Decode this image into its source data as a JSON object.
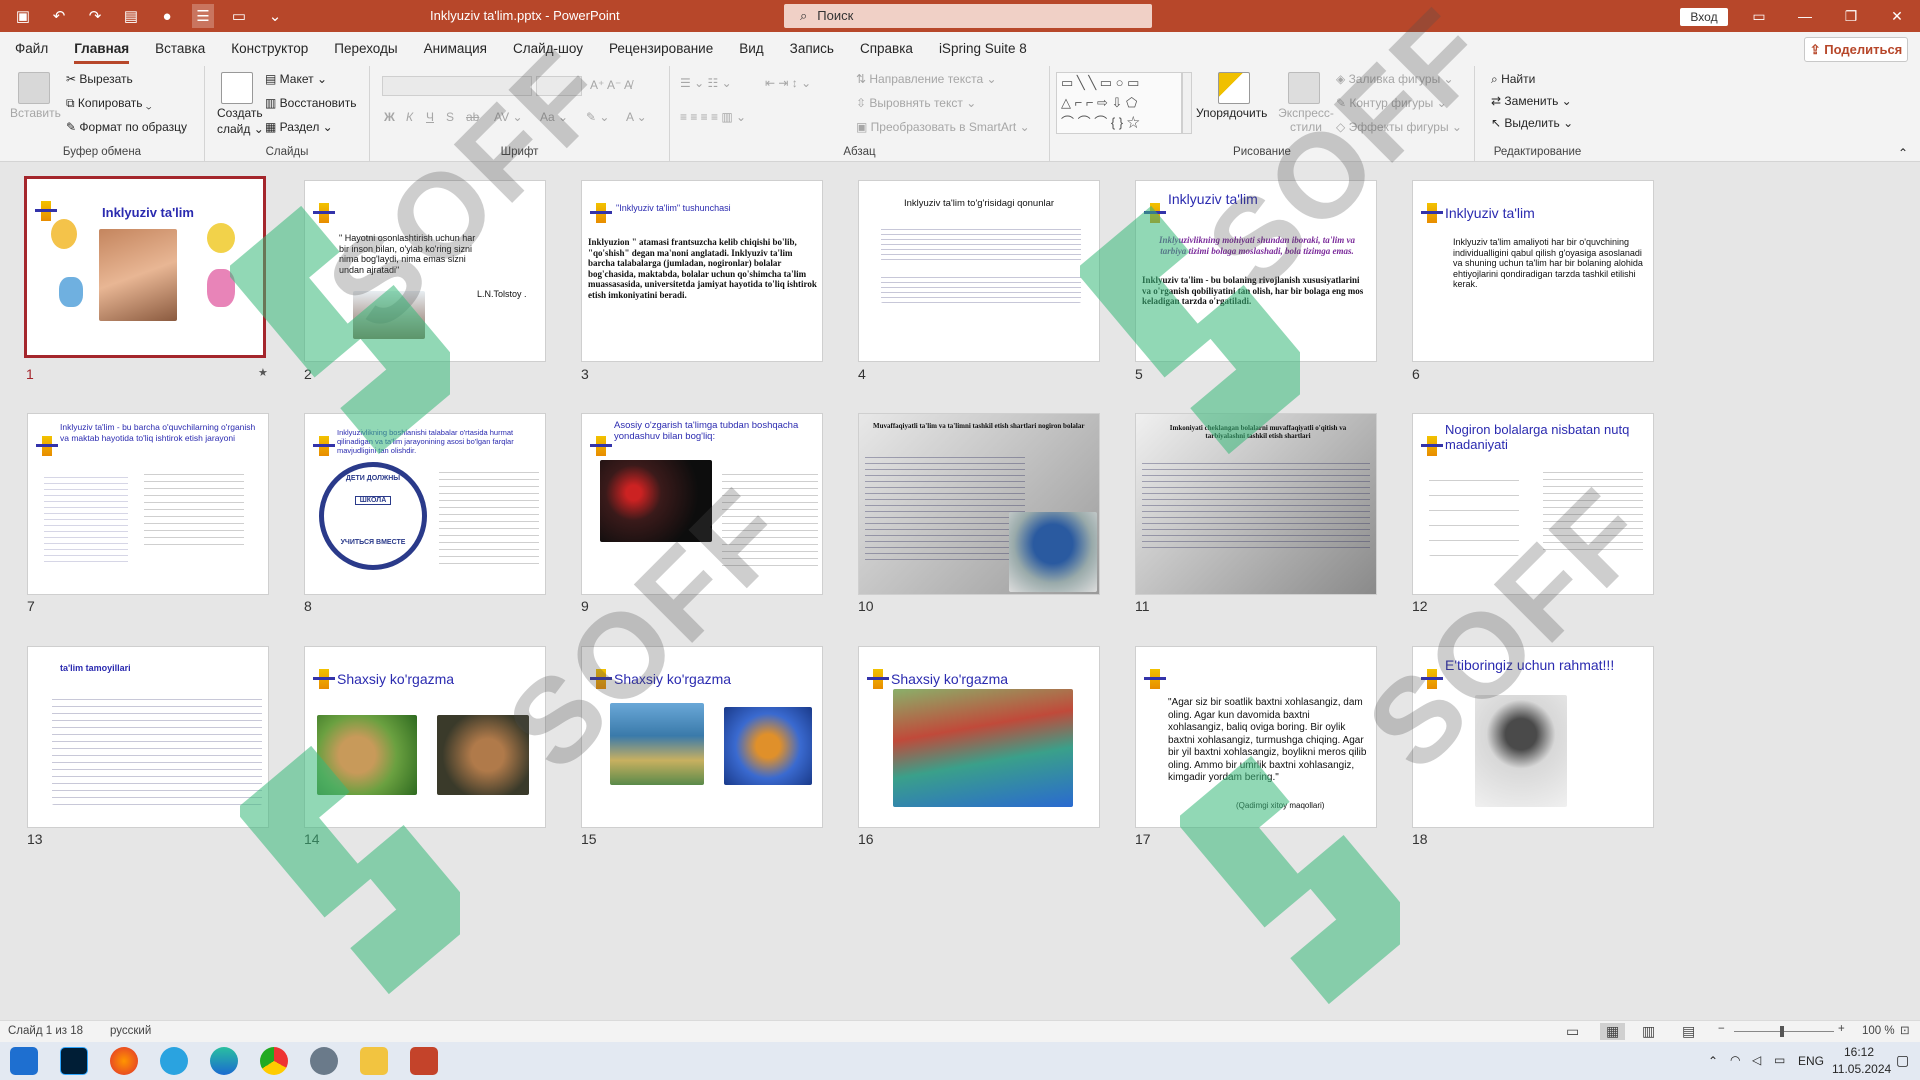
{
  "titlebar": {
    "doc_title": "Inklyuziv ta'lim.pptx  -  PowerPoint",
    "search_placeholder": "Поиск",
    "login": "Вход"
  },
  "tabs": [
    "Файл",
    "Главная",
    "Вставка",
    "Конструктор",
    "Переходы",
    "Анимация",
    "Слайд-шоу",
    "Рецензирование",
    "Вид",
    "Запись",
    "Справка",
    "iSpring Suite 8"
  ],
  "share_label": "Поделиться",
  "ribbon": {
    "clipboard": {
      "paste": "Вставить",
      "cut": "Вырезать",
      "copy": "Копировать",
      "format": "Формат по образцу",
      "label": "Буфер обмена"
    },
    "slides": {
      "create": "Создать",
      "slide": "слайд",
      "layout": "Макет",
      "restore": "Восстановить",
      "section": "Раздел",
      "label": "Слайды"
    },
    "font": {
      "label": "Шрифт"
    },
    "paragraph": {
      "text_dir": "Направление текста",
      "align_text": "Выровнять текст",
      "smartart": "Преобразовать в SmartArt",
      "label": "Абзац"
    },
    "drawing": {
      "arrange": "Упорядочить",
      "styles": "Экспресс-стили",
      "fill": "Заливка фигуры",
      "outline": "Контур фигуры",
      "effects": "Эффекты фигуры",
      "label": "Рисование"
    },
    "editing": {
      "find": "Найти",
      "replace": "Заменить",
      "select": "Выделить",
      "label": "Редактирование"
    }
  },
  "slides": [
    {
      "n": "1",
      "title": "Inklyuziv ta'lim"
    },
    {
      "n": "2",
      "quote": "\" Hayotni osonlashtirish uchun har bir inson bilan, o'ylab ko'ring sizni nima bog'laydi, nima emas sizni undan ajratadi\"",
      "author": "L.N.Tolstoy ."
    },
    {
      "n": "3",
      "title": "\"Inklyuziv ta'lim\" tushunchasi",
      "body": "Inklyuzion \" atamasi frantsuzcha kelib chiqishi bo'lib, \"qo'shish\" degan ma'noni anglatadi. Inklyuziv ta'lim barcha talabalarga (jumladan, nogironlar) bolalar bog'chasida, maktabda, bolalar uchun qo'shimcha ta'lim muassasasida, universitetda jamiyat hayotida to'liq ishtirok etish imkoniyatini beradi."
    },
    {
      "n": "4",
      "title": "Inklyuziv ta'lim to'g'risidagi qonunlar"
    },
    {
      "n": "5",
      "title": "Inklyuziv ta'lim",
      "italic": "Inklyuzivlikning mohiyati shundan iboraki, ta'lim va tarbiya tizimi bolaga moslashadi, bola tizimga emas.",
      "body": "Inklyuziv ta'lim - bu bolaning rivojlanish xususiyatlarini va o'rganish qobiliyatini tan olish, har bir bolaga eng mos keladigan tarzda o'rgatiladi."
    },
    {
      "n": "6",
      "title": "Inklyuziv ta'lim",
      "body": "Inklyuziv ta'lim amaliyoti har bir o'quvchining individualligini qabul qilish g'oyasiga asoslanadi va shuning uchun ta'lim har bir bolaning alohida ehtiyojlarini qondiradigan tarzda tashkil etilishi kerak."
    },
    {
      "n": "7",
      "title": "Inklyuziv ta'lim - bu barcha o'quvchilarning o'rganish va maktab hayotida to'liq ishtirok etish jarayoni"
    },
    {
      "n": "8",
      "title": "Inklyuzivlikning boshlanishi talabalar o'rtasida hurmat qilinadigan va ta'lim jarayonining asosi bo'lgan farqlar mavjudligini tan olishdir.",
      "badge_top": "ДЕТИ ДОЛЖНЫ",
      "badge_mid": "ШКОЛА",
      "badge_bot": "УЧИТЬСЯ ВМЕСТЕ"
    },
    {
      "n": "9",
      "title": "Asosiy o'zgarish ta'limga tubdan boshqacha yondashuv bilan bog'liq:"
    },
    {
      "n": "10",
      "title": "Muvaffaqiyatli ta'lim va ta'limni tashkil etish shartlari nogiron bolalar"
    },
    {
      "n": "11",
      "title": "Imkoniyati cheklangan bolalarni muvaffaqiyatli o'qitish va tarbiyalashni tashkil etish shartlari"
    },
    {
      "n": "12",
      "title": "Nogiron bolalarga nisbatan nutq madaniyati"
    },
    {
      "n": "13",
      "title": "ta'lim tamoyillari"
    },
    {
      "n": "14",
      "title": "Shaxsiy ko'rgazma"
    },
    {
      "n": "15",
      "title": "Shaxsiy ko'rgazma"
    },
    {
      "n": "16",
      "title": "Shaxsiy ko'rgazma"
    },
    {
      "n": "17",
      "quote": "\"Agar siz bir soatlik baxtni xohlasangiz, dam oling. Agar kun davomida baxtni xohlasangiz, baliq oviga boring. Bir oylik baxtni xohlasangiz, turmushga chiqing. Agar bir yil baxtni xohlasangiz, boylikni meros qilib oling. Ammo bir umrlik baxtni xohlasangiz, kimgadir yordam bering.\"",
      "author": "(Qadimgi xitoy maqollari)"
    },
    {
      "n": "18",
      "title": "E'tiboringiz uchun rahmat!!!"
    }
  ],
  "status": {
    "slide": "Слайд 1 из 18",
    "lang": "русский",
    "zoom": "100 %"
  },
  "tray": {
    "lang": "ENG",
    "time": "16:12",
    "date": "11.05.2024"
  },
  "watermark": "SOFF"
}
